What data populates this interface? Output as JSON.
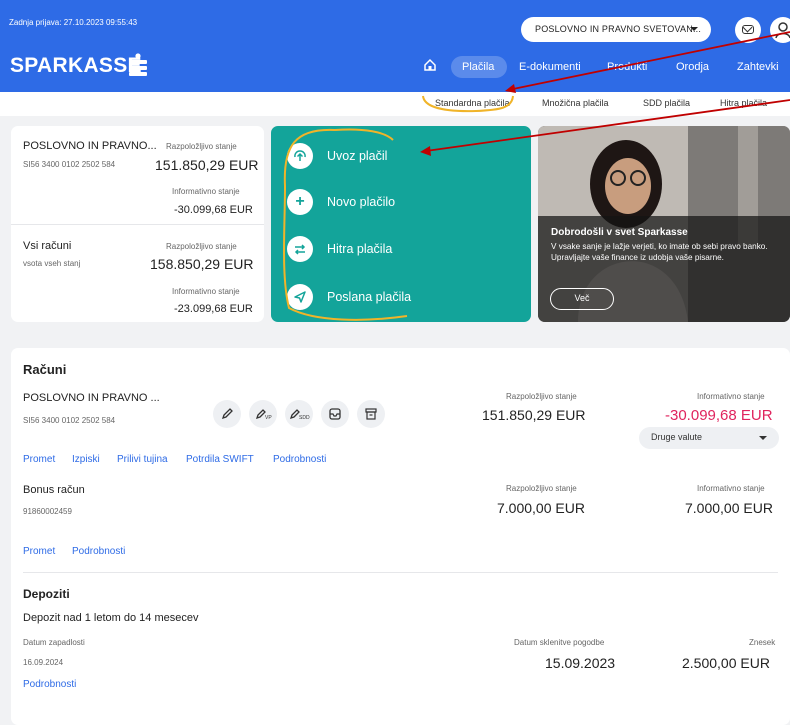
{
  "header": {
    "last_login": "Zadnja prijava: 27.10.2023 09:55:43",
    "account_selector": "POSLOVNO IN PRAVNO SVETOVAN...",
    "brand": "SPARKASSE"
  },
  "nav": {
    "home_icon": "home-icon",
    "items": [
      "Plačila",
      "E-dokumenti",
      "Produkti",
      "Orodja",
      "Zahtevki"
    ]
  },
  "subnav": {
    "items": [
      "Standardna plačila",
      "Množična plačila",
      "SDD plačila",
      "Hitra plačila"
    ]
  },
  "summary": {
    "account_name": "POSLOVNO IN PRAVNO...",
    "account_iban": "SI56 3400 0102 2502 584",
    "available_label": "Razpoložljivo stanje",
    "available_value": "151.850,29 EUR",
    "info_label": "Informativno stanje",
    "info_value": "-30.099,68 EUR",
    "all_label": "Vsi računi",
    "all_sub": "vsota vseh stanj",
    "all_available_label": "Razpoložljivo stanje",
    "all_available_value": "158.850,29 EUR",
    "all_info_label": "Informativno stanje",
    "all_info_value": "-23.099,68 EUR"
  },
  "actions": [
    "Uvoz plačil",
    "Novo plačilo",
    "Hitra plačila",
    "Poslana plačila"
  ],
  "promo": {
    "title": "Dobrodošli v svet Sparkasse",
    "text": "V vsake sanje je lažje verjeti, ko imate ob sebi pravo banko. Upravljajte vaše finance iz udobja vaše pisarne.",
    "button": "Več"
  },
  "accounts": {
    "title": "Računi",
    "main": {
      "name": "POSLOVNO IN PRAVNO ...",
      "iban": "SI56 3400 0102 2502 584",
      "available_label": "Razpoložljivo stanje",
      "available_value": "151.850,29 EUR",
      "info_label": "Informativno stanje",
      "info_value": "-30.099,68 EUR",
      "currency_select": "Druge valute",
      "tool_labels": [
        "",
        "VP",
        "SDD",
        "",
        ""
      ],
      "links": [
        "Promet",
        "Izpiski",
        "Prilivi tujina",
        "Potrdila SWIFT",
        "Podrobnosti"
      ]
    },
    "bonus": {
      "name": "Bonus račun",
      "number": "91860002459",
      "available_label": "Razpoložljivo stanje",
      "available_value": "7.000,00 EUR",
      "info_label": "Informativno stanje",
      "info_value": "7.000,00 EUR",
      "links": [
        "Promet",
        "Podrobnosti"
      ]
    }
  },
  "deposits": {
    "title": "Depoziti",
    "name": "Depozit nad 1 letom do 14 mesecev",
    "maturity_label": "Datum zapadlosti",
    "maturity_value": "16.09.2024",
    "contract_label": "Datum sklenitve pogodbe",
    "contract_value": "15.09.2023",
    "amount_label": "Znesek",
    "amount_value": "2.500,00 EUR",
    "link": "Podrobnosti"
  },
  "colors": {
    "brand_blue": "#2e6be6",
    "teal": "#13a49a",
    "negative": "#e0245e",
    "annotation": "#c00000",
    "highlight": "#f0b429"
  }
}
